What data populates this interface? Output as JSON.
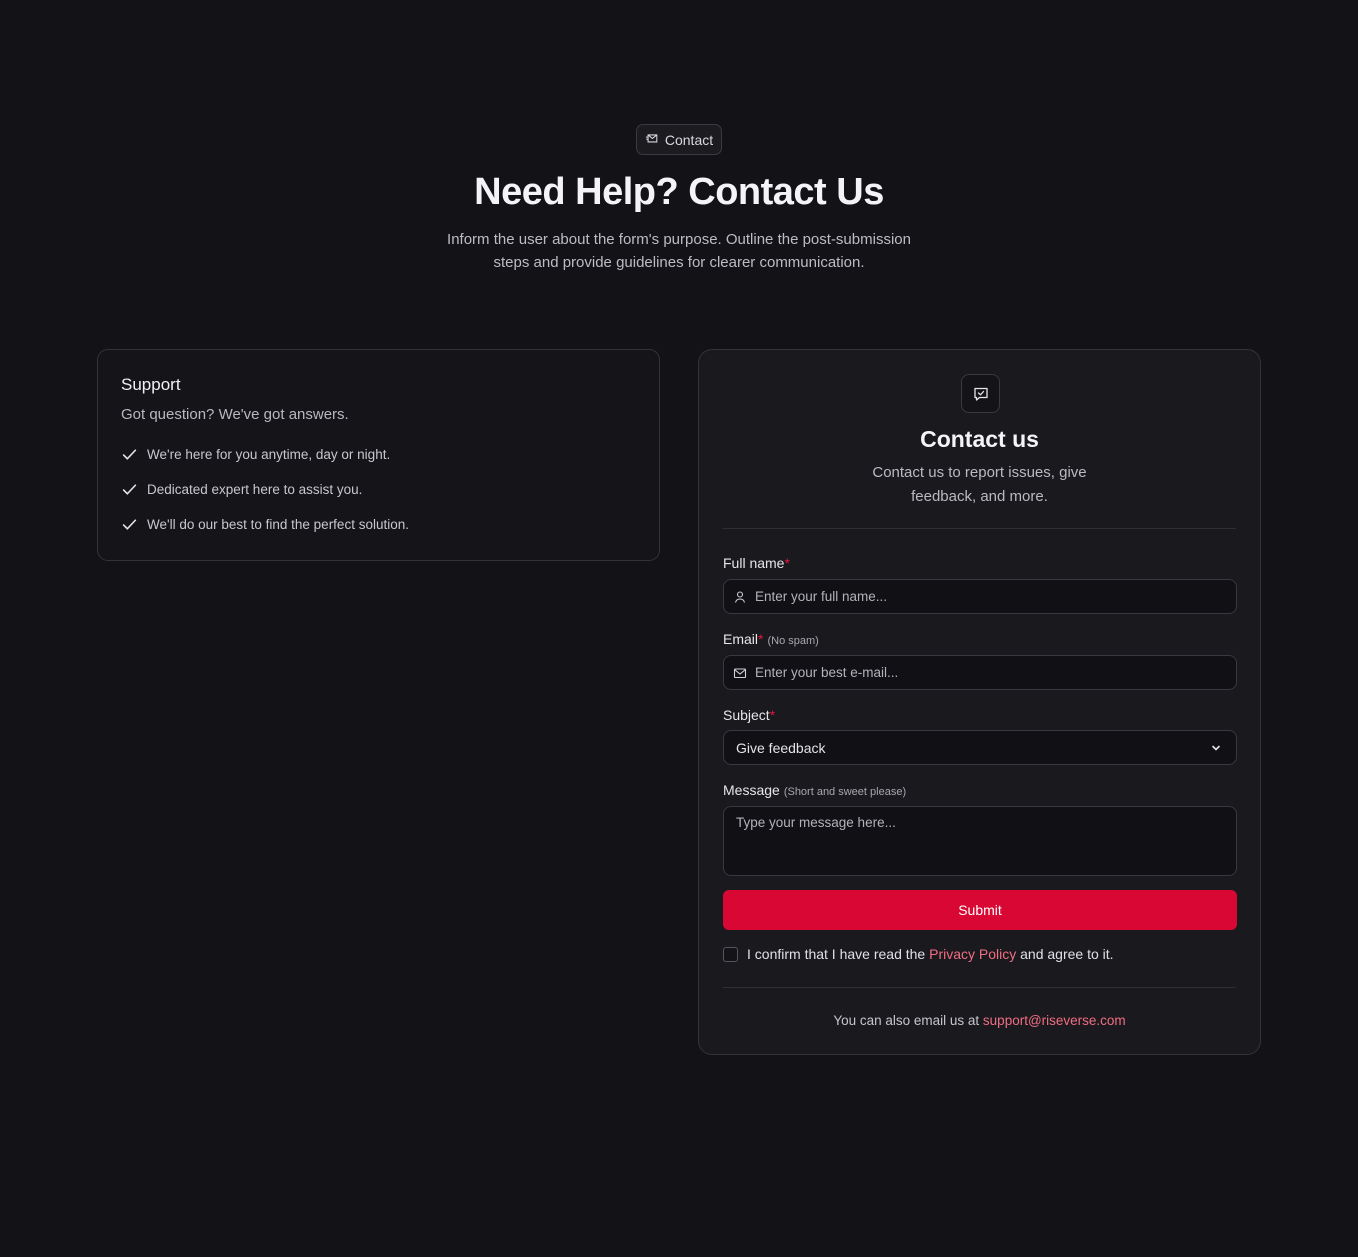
{
  "header": {
    "badge_label": "Contact",
    "title": "Need Help? Contact Us",
    "subtitle": "Inform the user about the form's purpose. Outline the post-submission steps and provide guidelines for clearer communication."
  },
  "support": {
    "title": "Support",
    "subtitle": "Got question? We've got answers.",
    "items": [
      "We're here for you anytime, day or night.",
      "Dedicated expert here to assist you.",
      "We'll do our best to find the perfect solution."
    ]
  },
  "contact": {
    "title": "Contact us",
    "description": "Contact us to report issues, give feedback, and more.",
    "full_name": {
      "label": "Full name",
      "required_mark": "*",
      "placeholder": "Enter your full name...",
      "value": ""
    },
    "email": {
      "label": "Email",
      "required_mark": "*",
      "hint": "(No spam)",
      "placeholder": "Enter your best e-mail...",
      "value": ""
    },
    "subject": {
      "label": "Subject",
      "required_mark": "*",
      "selected": "Give feedback"
    },
    "message": {
      "label": "Message",
      "hint": "(Short and sweet please)",
      "placeholder": "Type your message here...",
      "value": ""
    },
    "submit_label": "Submit",
    "consent": {
      "prefix": "I confirm that I have read the",
      "link": "Privacy Policy",
      "suffix": "and agree to it.",
      "checked": false
    },
    "footer": {
      "prefix": "You can also email us at",
      "email": "support@riseverse.com"
    }
  },
  "colors": {
    "background": "#131217",
    "card": "#1a191e",
    "accent": "#d90734",
    "link": "#f06e83",
    "required": "#e0173c"
  },
  "icons": {
    "badge": "mail-send-icon",
    "contact": "message-square-icon",
    "check": "check-icon",
    "full_name": "user-icon",
    "email": "mail-icon",
    "subject": "chevron-down-icon"
  }
}
